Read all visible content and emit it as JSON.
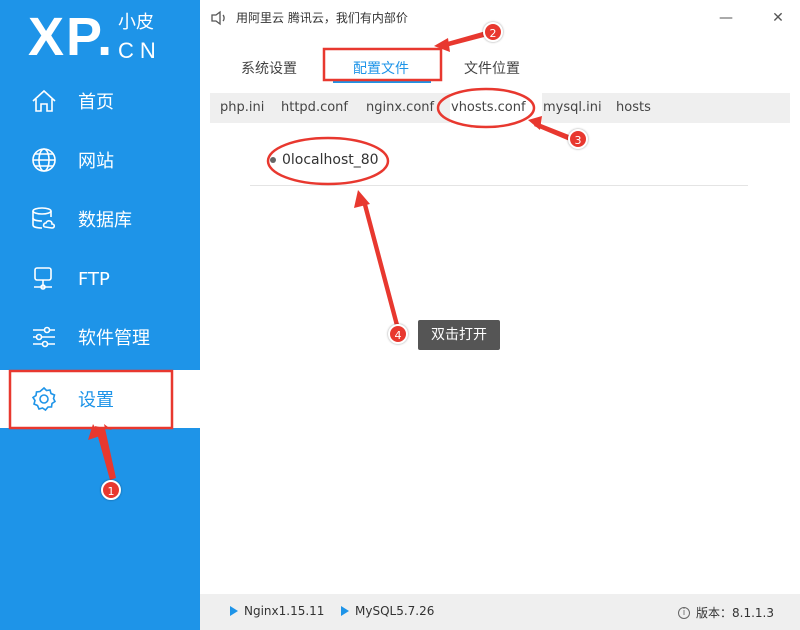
{
  "app": {
    "logo_main": "XP.",
    "logo_top": "小皮",
    "logo_bottom": "CN",
    "notice": "用阿里云 腾讯云，我们有内部价"
  },
  "sidebar": {
    "items": [
      {
        "label": "首页",
        "icon": "home-icon"
      },
      {
        "label": "网站",
        "icon": "globe-icon"
      },
      {
        "label": "数据库",
        "icon": "database-icon"
      },
      {
        "label": "FTP",
        "icon": "ftp-server-icon"
      },
      {
        "label": "软件管理",
        "icon": "sliders-icon"
      },
      {
        "label": "设置",
        "icon": "gear-icon",
        "active": true
      }
    ]
  },
  "window": {
    "min_glyph": "—",
    "close_glyph": "✕"
  },
  "tabs": [
    {
      "label": "系统设置"
    },
    {
      "label": "配置文件",
      "active": true
    },
    {
      "label": "文件位置"
    }
  ],
  "subtabs": [
    {
      "label": "php.ini"
    },
    {
      "label": "httpd.conf"
    },
    {
      "label": "nginx.conf"
    },
    {
      "label": "vhosts.conf",
      "active": true
    },
    {
      "label": "mysql.ini"
    },
    {
      "label": "hosts"
    }
  ],
  "vhosts": [
    {
      "label": "0localhost_80"
    }
  ],
  "status": {
    "nginx": "Nginx1.15.11",
    "mysql": "MySQL5.7.26",
    "version": "版本：8.1.1.3"
  },
  "annotations": {
    "badges": [
      "1",
      "2",
      "3",
      "4"
    ],
    "tooltip": "双击打开"
  },
  "colors": {
    "accent": "#1e94e8",
    "annotation": "#e8382f"
  }
}
